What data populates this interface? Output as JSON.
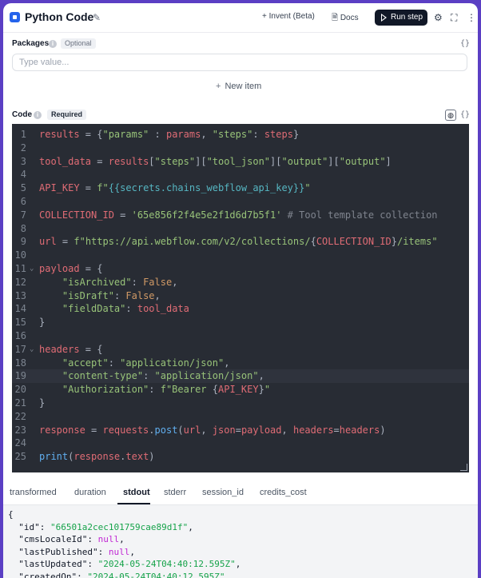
{
  "header": {
    "title": "Python Code",
    "invent_label": "Invent (Beta)",
    "docs_label": "Docs",
    "run_label": "Run step"
  },
  "packages": {
    "label": "Packages",
    "tag": "Optional",
    "placeholder": "Type value...",
    "new_item_label": "New item"
  },
  "code": {
    "label": "Code",
    "tag": "Required",
    "lines": [
      [
        {
          "t": "results",
          "c": "var"
        },
        {
          "t": " = {",
          "c": "plain"
        },
        {
          "t": "\"params\"",
          "c": "str"
        },
        {
          "t": " : ",
          "c": "plain"
        },
        {
          "t": "params",
          "c": "var"
        },
        {
          "t": ", ",
          "c": "plain"
        },
        {
          "t": "\"steps\"",
          "c": "str"
        },
        {
          "t": ": ",
          "c": "plain"
        },
        {
          "t": "steps",
          "c": "var"
        },
        {
          "t": "}",
          "c": "plain"
        }
      ],
      [],
      [
        {
          "t": "tool_data",
          "c": "var"
        },
        {
          "t": " = ",
          "c": "plain"
        },
        {
          "t": "results",
          "c": "var"
        },
        {
          "t": "[",
          "c": "plain"
        },
        {
          "t": "\"steps\"",
          "c": "str"
        },
        {
          "t": "][",
          "c": "plain"
        },
        {
          "t": "\"tool_json\"",
          "c": "str"
        },
        {
          "t": "][",
          "c": "plain"
        },
        {
          "t": "\"output\"",
          "c": "str"
        },
        {
          "t": "][",
          "c": "plain"
        },
        {
          "t": "\"output\"",
          "c": "str"
        },
        {
          "t": "]",
          "c": "plain"
        }
      ],
      [],
      [
        {
          "t": "API_KEY",
          "c": "var"
        },
        {
          "t": " = ",
          "c": "plain"
        },
        {
          "t": "f\"",
          "c": "str"
        },
        {
          "t": "{{secrets.chains_webflow_api_key}}",
          "c": "interp"
        },
        {
          "t": "\"",
          "c": "str"
        }
      ],
      [],
      [
        {
          "t": "COLLECTION_ID",
          "c": "var"
        },
        {
          "t": " = ",
          "c": "plain"
        },
        {
          "t": "'65e856f2f4e5e2f1d6d7b5f1'",
          "c": "str"
        },
        {
          "t": " # Tool template collection",
          "c": "com"
        }
      ],
      [],
      [
        {
          "t": "url",
          "c": "var"
        },
        {
          "t": " = ",
          "c": "plain"
        },
        {
          "t": "f\"https://api.webflow.com/v2/collections/",
          "c": "str"
        },
        {
          "t": "{",
          "c": "plain"
        },
        {
          "t": "COLLECTION_ID",
          "c": "var"
        },
        {
          "t": "}",
          "c": "plain"
        },
        {
          "t": "/items\"",
          "c": "str"
        }
      ],
      [],
      [
        {
          "t": "payload",
          "c": "var"
        },
        {
          "t": " = {",
          "c": "plain"
        }
      ],
      [
        {
          "t": "    ",
          "c": "plain"
        },
        {
          "t": "\"isArchived\"",
          "c": "str"
        },
        {
          "t": ": ",
          "c": "plain"
        },
        {
          "t": "False",
          "c": "kw"
        },
        {
          "t": ",",
          "c": "plain"
        }
      ],
      [
        {
          "t": "    ",
          "c": "plain"
        },
        {
          "t": "\"isDraft\"",
          "c": "str"
        },
        {
          "t": ": ",
          "c": "plain"
        },
        {
          "t": "False",
          "c": "kw"
        },
        {
          "t": ",",
          "c": "plain"
        }
      ],
      [
        {
          "t": "    ",
          "c": "plain"
        },
        {
          "t": "\"fieldData\"",
          "c": "str"
        },
        {
          "t": ": ",
          "c": "plain"
        },
        {
          "t": "tool_data",
          "c": "var"
        }
      ],
      [
        {
          "t": "}",
          "c": "plain"
        }
      ],
      [],
      [
        {
          "t": "headers",
          "c": "var"
        },
        {
          "t": " = {",
          "c": "plain"
        }
      ],
      [
        {
          "t": "    ",
          "c": "plain"
        },
        {
          "t": "\"accept\"",
          "c": "str"
        },
        {
          "t": ": ",
          "c": "plain"
        },
        {
          "t": "\"application/json\"",
          "c": "str"
        },
        {
          "t": ",",
          "c": "plain"
        }
      ],
      [
        {
          "t": "    ",
          "c": "plain"
        },
        {
          "t": "\"content-type\"",
          "c": "str"
        },
        {
          "t": ": ",
          "c": "plain"
        },
        {
          "t": "\"application/json\"",
          "c": "str"
        },
        {
          "t": ",",
          "c": "plain"
        }
      ],
      [
        {
          "t": "    ",
          "c": "plain"
        },
        {
          "t": "\"Authorization\"",
          "c": "str"
        },
        {
          "t": ": ",
          "c": "plain"
        },
        {
          "t": "f\"Bearer ",
          "c": "str"
        },
        {
          "t": "{",
          "c": "plain"
        },
        {
          "t": "API_KEY",
          "c": "var"
        },
        {
          "t": "}",
          "c": "plain"
        },
        {
          "t": "\"",
          "c": "str"
        }
      ],
      [
        {
          "t": "}",
          "c": "plain"
        }
      ],
      [],
      [
        {
          "t": "response",
          "c": "var"
        },
        {
          "t": " = ",
          "c": "plain"
        },
        {
          "t": "requests",
          "c": "var"
        },
        {
          "t": ".",
          "c": "plain"
        },
        {
          "t": "post",
          "c": "fn"
        },
        {
          "t": "(",
          "c": "plain"
        },
        {
          "t": "url",
          "c": "var"
        },
        {
          "t": ", ",
          "c": "plain"
        },
        {
          "t": "json",
          "c": "var"
        },
        {
          "t": "=",
          "c": "plain"
        },
        {
          "t": "payload",
          "c": "var"
        },
        {
          "t": ", ",
          "c": "plain"
        },
        {
          "t": "headers",
          "c": "var"
        },
        {
          "t": "=",
          "c": "plain"
        },
        {
          "t": "headers",
          "c": "var"
        },
        {
          "t": ")",
          "c": "plain"
        }
      ],
      [],
      [
        {
          "t": "print",
          "c": "fn"
        },
        {
          "t": "(",
          "c": "plain"
        },
        {
          "t": "response",
          "c": "var"
        },
        {
          "t": ".",
          "c": "plain"
        },
        {
          "t": "text",
          "c": "var"
        },
        {
          "t": ")",
          "c": "plain"
        }
      ]
    ],
    "fold_lines": [
      11,
      17
    ],
    "active_line": 19
  },
  "output": {
    "tabs": [
      "transformed",
      "duration",
      "stdout",
      "stderr",
      "session_id",
      "credits_cost"
    ],
    "active_tab": "stdout",
    "lines": [
      [
        {
          "t": "{",
          "c": "p"
        }
      ],
      [
        {
          "t": "  \"id\"",
          "c": "key"
        },
        {
          "t": ": ",
          "c": "p"
        },
        {
          "t": "\"66501a2cec101759cae89d1f\"",
          "c": "str"
        },
        {
          "t": ",",
          "c": "p"
        }
      ],
      [
        {
          "t": "  \"cmsLocaleId\"",
          "c": "key"
        },
        {
          "t": ": ",
          "c": "p"
        },
        {
          "t": "null",
          "c": "null"
        },
        {
          "t": ",",
          "c": "p"
        }
      ],
      [
        {
          "t": "  \"lastPublished\"",
          "c": "key"
        },
        {
          "t": ": ",
          "c": "p"
        },
        {
          "t": "null",
          "c": "null"
        },
        {
          "t": ",",
          "c": "p"
        }
      ],
      [
        {
          "t": "  \"lastUpdated\"",
          "c": "key"
        },
        {
          "t": ": ",
          "c": "p"
        },
        {
          "t": "\"2024-05-24T04:40:12.595Z\"",
          "c": "str"
        },
        {
          "t": ",",
          "c": "p"
        }
      ],
      [
        {
          "t": "  \"createdOn\"",
          "c": "key"
        },
        {
          "t": ": ",
          "c": "p"
        },
        {
          "t": "\"2024-05-24T04:40:12.595Z\"",
          "c": "str"
        },
        {
          "t": ",",
          "c": "p"
        }
      ]
    ]
  }
}
